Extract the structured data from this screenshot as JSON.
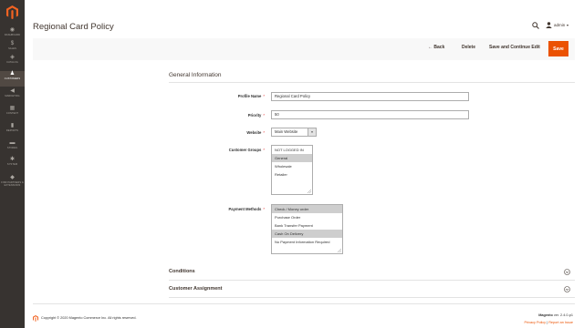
{
  "sidebar": {
    "items": [
      {
        "label": "DASHBOARD",
        "icon": "dashboard-icon",
        "glyph": "◉"
      },
      {
        "label": "SALES",
        "icon": "dollar-icon",
        "glyph": "$"
      },
      {
        "label": "CATALOG",
        "icon": "box-icon",
        "glyph": "◈"
      },
      {
        "label": "CUSTOMERS",
        "icon": "person-icon",
        "glyph": "♟"
      },
      {
        "label": "MARKETING",
        "icon": "megaphone-icon",
        "glyph": "◀"
      },
      {
        "label": "CONTENT",
        "icon": "layout-icon",
        "glyph": "▦"
      },
      {
        "label": "REPORTS",
        "icon": "bar-chart-icon",
        "glyph": "▮"
      },
      {
        "label": "STORES",
        "icon": "store-icon",
        "glyph": "▬"
      },
      {
        "label": "SYSTEM",
        "icon": "gear-icon",
        "glyph": "✱"
      },
      {
        "label": "FIND PARTNERS & EXTENSIONS",
        "icon": "extensions-icon",
        "glyph": "◆"
      }
    ]
  },
  "header": {
    "title": "Regional Card Policy",
    "user": "admin",
    "caret": "▾"
  },
  "actions": {
    "back": "← Back",
    "delete": "Delete",
    "save_continue": "Save and Continue Edit",
    "save": "Save"
  },
  "section": {
    "title": "General Information"
  },
  "form": {
    "profile_name": {
      "label": "Profile Name",
      "value": "Regional Card Policy"
    },
    "priority": {
      "label": "Priority",
      "value": "50"
    },
    "website": {
      "label": "Website",
      "value": "Main Website"
    },
    "customer_groups": {
      "label": "Customer Groups",
      "options": [
        "NOT LOGGED IN",
        "General",
        "Wholesale",
        "Retailer"
      ],
      "selected": [
        1
      ]
    },
    "payment_methods": {
      "label": "Payment Methods",
      "options": [
        "Check / Money order",
        "Purchase Order",
        "Bank Transfer Payment",
        "Cash On Delivery",
        "No Payment Information Required"
      ],
      "selected": [
        0,
        3
      ]
    },
    "required_mark": "*"
  },
  "collapsibles": [
    "Conditions",
    "Customer Assignment"
  ],
  "footer": {
    "copyright": "Copyright © 2020 Magento Commerce Inc. All rights reserved.",
    "version_brand": "Magento",
    "version_text": " ver. 2.4.0-p1",
    "privacy": "Privacy Policy",
    "separator": " | ",
    "report": "Report an Issue"
  },
  "colors": {
    "accent": "#eb5202",
    "sidebar_bg": "#373330",
    "sidebar_active": "#514943"
  }
}
